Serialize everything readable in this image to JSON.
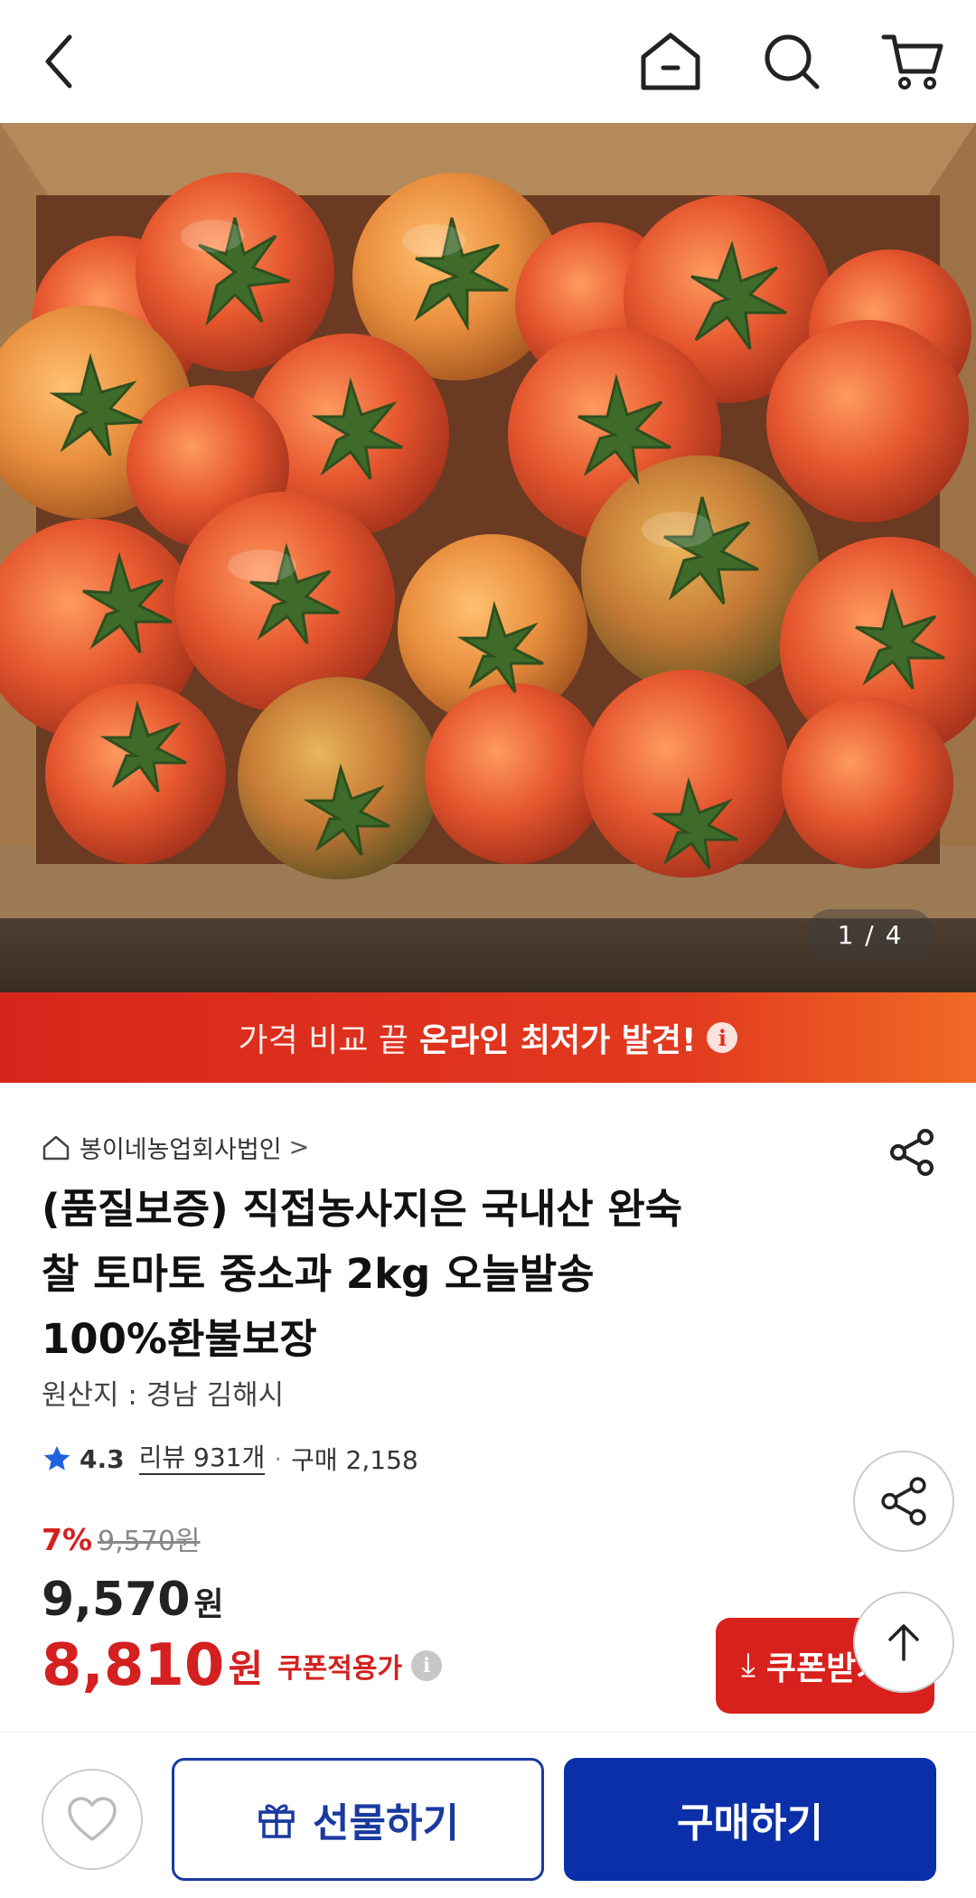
{
  "hero": {
    "counter": "1 / 4"
  },
  "promo": {
    "light_text": "가격 비교 끝",
    "bold_text": "온라인 최저가 발견!",
    "info_glyph": "i"
  },
  "seller": {
    "name": "봉이네농업회사법인",
    "chevron": ">"
  },
  "product": {
    "title_lines": [
      "(품질보증) 직접농사지은 국내산 완숙",
      "찰 토마토 중소과 2kg 오늘발송",
      "100%환불보장"
    ],
    "origin": "원산지 : 경남 김해시"
  },
  "rating": {
    "score": "4.3",
    "reviews": "리뷰 931개",
    "dot": "·",
    "purchases": "구매 2,158"
  },
  "price": {
    "discount": "7%",
    "original": "9,570원",
    "current_num": "9,570",
    "current_unit": "원",
    "coupon_num": "8,810",
    "coupon_unit": "원",
    "coupon_label": "쿠폰적용가",
    "info_glyph": "i"
  },
  "coupon_button": {
    "arrow": "⤓",
    "label": "쿠폰받기"
  },
  "bottom": {
    "gift_label": "선물하기",
    "buy_label": "구매하기"
  },
  "icons": [
    "back-icon",
    "home-icon",
    "search-icon",
    "cart-icon",
    "share-icon",
    "arrow-up-icon",
    "heart-icon",
    "gift-icon",
    "star-icon"
  ]
}
